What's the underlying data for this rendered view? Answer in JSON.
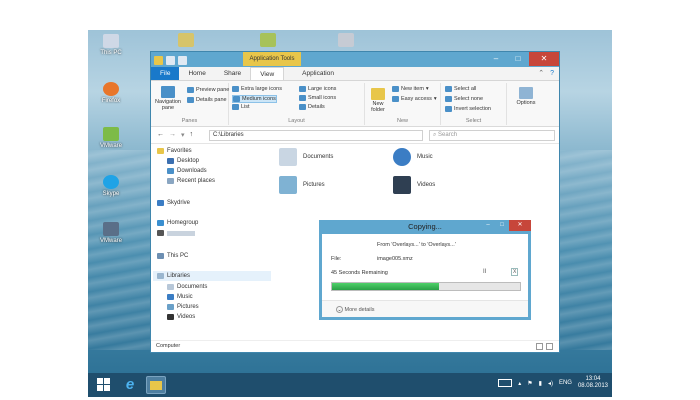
{
  "desktop": {
    "icons": [
      {
        "label": "This PC"
      },
      {
        "label": "Firefox"
      },
      {
        "label": "VMware"
      },
      {
        "label": "Skype"
      },
      {
        "label": "VMware"
      }
    ]
  },
  "explorer": {
    "context_tab": "Application Tools",
    "window_buttons": {
      "minimize": "–",
      "maximize": "□",
      "close": "✕"
    },
    "tabs": [
      "File",
      "Home",
      "Share",
      "View",
      "Application"
    ],
    "ribbon": {
      "panes": {
        "navigation_pane": "Navigation pane",
        "preview_pane": "Preview pane",
        "details_pane": "Details pane",
        "label": "Panes"
      },
      "layout": {
        "extra_large_icons": "Extra large icons",
        "large_icons": "Large icons",
        "medium_icons": "Medium icons",
        "small_icons": "Small icons",
        "list": "List",
        "details": "Details",
        "label": "Layout"
      },
      "new": {
        "new_folder": "New folder",
        "new_item": "New item",
        "easy_access": "Easy access",
        "label": "New"
      },
      "select": {
        "select_all": "Select all",
        "select_none": "Select none",
        "invert_selection": "Invert selection",
        "label": "Select"
      },
      "options": "Options"
    },
    "address": {
      "path": "C:\\Libraries",
      "search_placeholder": "Search"
    },
    "sidebar": {
      "favorites": "Favorites",
      "favorites_items": [
        "Desktop",
        "Downloads",
        "Recent places"
      ],
      "skydrive": "Skydrive",
      "homegroup": "Homegroup",
      "this_pc": "This PC",
      "libraries": "Libraries",
      "libraries_items": [
        "Documents",
        "Music",
        "Pictures",
        "Videos"
      ],
      "computer": "Computer"
    },
    "content_items": [
      "Documents",
      "Music",
      "Pictures",
      "Videos"
    ]
  },
  "copy_dialog": {
    "title": "Copying...",
    "from_to": "From 'Overlays...' to 'Overlays...'",
    "file_label": "File:",
    "file_name": "image005.xmz",
    "remaining": "45 Seconds Remaining",
    "progress": 0.57,
    "pause": "II",
    "cancel": "X",
    "more_details": "More details"
  },
  "taskbar": {
    "language": "ENG",
    "time": "13:04",
    "date": "08.08.2013"
  },
  "colors": {
    "accent": "#5fa7cf",
    "file_tab": "#1979ca",
    "close": "#c7463a",
    "progress": "#2aa046"
  }
}
